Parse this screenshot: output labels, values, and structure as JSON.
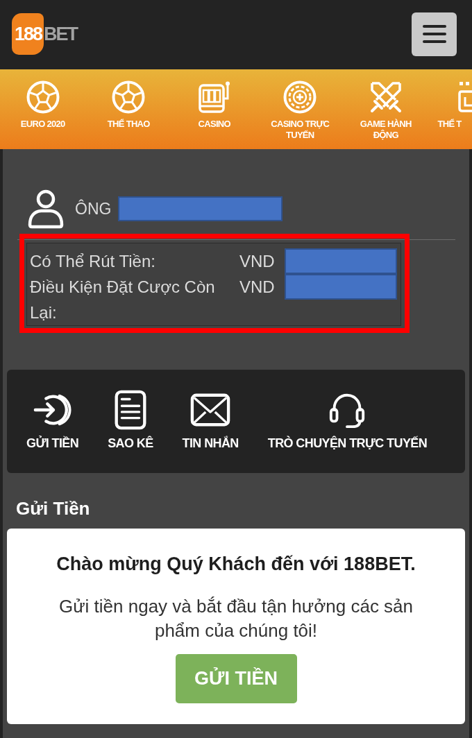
{
  "header": {
    "logo": {
      "mark": "188",
      "text": "BET"
    }
  },
  "nav": {
    "items": [
      {
        "label": "EURO 2020",
        "kind": "ball"
      },
      {
        "label": "THỂ THAO",
        "kind": "ball"
      },
      {
        "label": "CASINO",
        "kind": "slot"
      },
      {
        "label": "CASINO TRỰC TUYẾN",
        "kind": "chip"
      },
      {
        "label": "GAME HÀNH ĐỘNG",
        "kind": "swords"
      },
      {
        "label": "THỂ T",
        "kind": "tile"
      }
    ]
  },
  "account": {
    "salutation": "ÔNG",
    "name_redacted": true,
    "balances_highlighted": true,
    "balances": [
      {
        "label": "Có Thể Rút Tiền:",
        "currency": "VND",
        "redacted": true
      },
      {
        "label": "Điều Kiện Đặt Cược Còn Lại:",
        "currency": "VND",
        "redacted": true
      }
    ]
  },
  "actions": [
    {
      "label": "GỬI TIỀN",
      "kind": "deposit"
    },
    {
      "label": "SAO KÊ",
      "kind": "statement"
    },
    {
      "label": "TIN NHẮN",
      "kind": "message"
    },
    {
      "label": "TRÒ CHUYỆN TRỰC TUYẾN",
      "kind": "chat"
    }
  ],
  "deposit": {
    "heading": "Gửi Tiền",
    "welcome": "Chào mừng Quý Khách đến với 188BET.",
    "body": "Gửi tiền ngay và bắt đầu tận hưởng các sản phẩm của chúng tôi!",
    "button": "GỬI TIỀN"
  }
}
